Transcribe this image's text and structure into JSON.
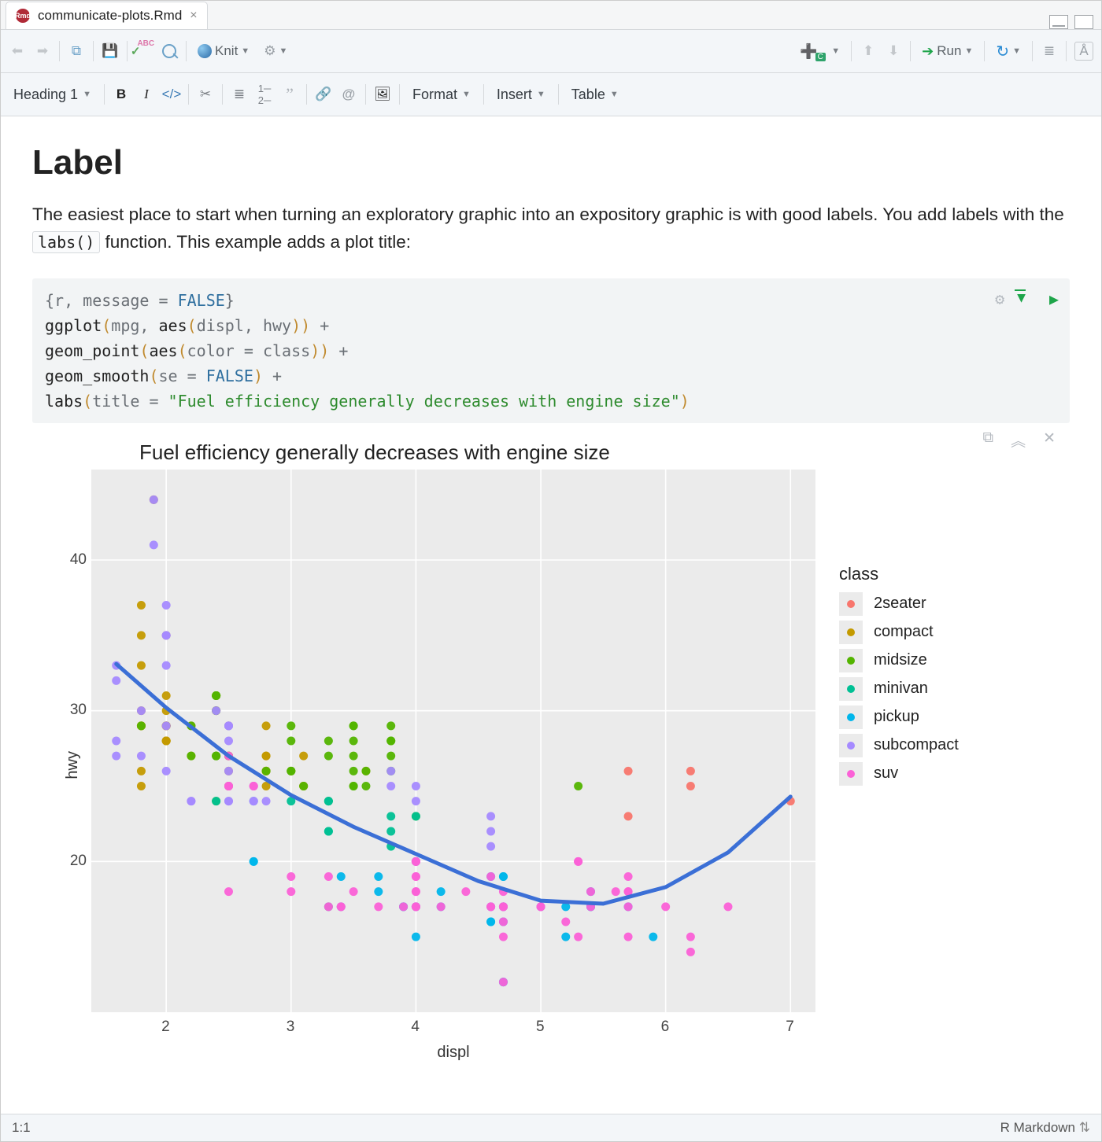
{
  "tab": {
    "filename": "communicate-plots.Rmd"
  },
  "toolbar": {
    "knit": "Knit",
    "run": "Run"
  },
  "toolbar2": {
    "style": "Heading 1",
    "format": "Format",
    "insert": "Insert",
    "table": "Table"
  },
  "document": {
    "heading": "Label",
    "para_pre": "The easiest place to start when turning an exploratory graphic into an expository graphic is with good labels. You add labels with the ",
    "code_inline": "labs()",
    "para_post": " function. This example adds a plot title:"
  },
  "chunk": {
    "header": "{r, message = FALSE}",
    "lines": [
      "ggplot(mpg, aes(displ, hwy)) +",
      "  geom_point(aes(color = class)) +",
      "  geom_smooth(se = FALSE) +",
      "  labs(title = \"Fuel efficiency generally decreases with engine size\")"
    ]
  },
  "chart_data": {
    "type": "scatter",
    "title": "Fuel efficiency generally decreases with engine size",
    "xlabel": "displ",
    "ylabel": "hwy",
    "xlim": [
      1.4,
      7.2
    ],
    "ylim": [
      10,
      46
    ],
    "xticks": [
      2,
      3,
      4,
      5,
      6,
      7
    ],
    "yticks": [
      20,
      30,
      40
    ],
    "legend_title": "class",
    "legend": [
      {
        "name": "2seater",
        "color": "#F8766D"
      },
      {
        "name": "compact",
        "color": "#C49A00"
      },
      {
        "name": "midsize",
        "color": "#53B400"
      },
      {
        "name": "minivan",
        "color": "#00C094"
      },
      {
        "name": "pickup",
        "color": "#00B6EB"
      },
      {
        "name": "subcompact",
        "color": "#A58AFF"
      },
      {
        "name": "suv",
        "color": "#FB61D7"
      }
    ],
    "smooth": [
      {
        "x": 1.6,
        "y": 33.1
      },
      {
        "x": 2.0,
        "y": 30.2
      },
      {
        "x": 2.5,
        "y": 27.0
      },
      {
        "x": 3.0,
        "y": 24.4
      },
      {
        "x": 3.5,
        "y": 22.3
      },
      {
        "x": 4.0,
        "y": 20.5
      },
      {
        "x": 4.5,
        "y": 18.7
      },
      {
        "x": 5.0,
        "y": 17.4
      },
      {
        "x": 5.5,
        "y": 17.2
      },
      {
        "x": 6.0,
        "y": 18.3
      },
      {
        "x": 6.5,
        "y": 20.6
      },
      {
        "x": 7.0,
        "y": 24.3
      }
    ],
    "series": [
      {
        "name": "2seater",
        "points": [
          [
            5.7,
            26
          ],
          [
            5.7,
            23
          ],
          [
            6.2,
            26
          ],
          [
            6.2,
            25
          ],
          [
            7.0,
            24
          ]
        ]
      },
      {
        "name": "compact",
        "points": [
          [
            1.8,
            29
          ],
          [
            1.8,
            29
          ],
          [
            2.0,
            31
          ],
          [
            2.0,
            30
          ],
          [
            2.8,
            26
          ],
          [
            2.8,
            27
          ],
          [
            3.1,
            27
          ],
          [
            1.8,
            26
          ],
          [
            1.8,
            25
          ],
          [
            2.0,
            28
          ],
          [
            2.0,
            29
          ],
          [
            2.8,
            27
          ],
          [
            2.8,
            25
          ],
          [
            3.1,
            25
          ],
          [
            3.1,
            25
          ],
          [
            2.4,
            30
          ],
          [
            2.4,
            30
          ],
          [
            2.5,
            26
          ],
          [
            2.5,
            27
          ],
          [
            2.2,
            27
          ],
          [
            2.2,
            29
          ],
          [
            2.4,
            31
          ],
          [
            2.4,
            31
          ],
          [
            3.0,
            26
          ],
          [
            1.8,
            30
          ],
          [
            1.8,
            33
          ],
          [
            1.8,
            35
          ],
          [
            1.8,
            37
          ],
          [
            2.0,
            35
          ],
          [
            2.0,
            29
          ],
          [
            2.0,
            29
          ],
          [
            2.0,
            28
          ],
          [
            2.0,
            28
          ],
          [
            2.8,
            26
          ],
          [
            1.9,
            44
          ],
          [
            2.0,
            29
          ],
          [
            2.5,
            29
          ],
          [
            1.8,
            29
          ],
          [
            1.8,
            29
          ],
          [
            2.0,
            28
          ],
          [
            2.0,
            29
          ],
          [
            2.8,
            29
          ],
          [
            2.8,
            26
          ],
          [
            3.6,
            26
          ]
        ]
      },
      {
        "name": "midsize",
        "points": [
          [
            2.4,
            27
          ],
          [
            3.1,
            25
          ],
          [
            3.5,
            25
          ],
          [
            3.6,
            25
          ],
          [
            2.4,
            24
          ],
          [
            2.4,
            27
          ],
          [
            3.3,
            24
          ],
          [
            2.5,
            25
          ],
          [
            2.5,
            27
          ],
          [
            3.5,
            29
          ],
          [
            3.5,
            28
          ],
          [
            3.0,
            26
          ],
          [
            3.0,
            29
          ],
          [
            3.5,
            26
          ],
          [
            3.3,
            28
          ],
          [
            3.8,
            26
          ],
          [
            3.8,
            28
          ],
          [
            3.8,
            27
          ],
          [
            5.3,
            25
          ],
          [
            2.2,
            27
          ],
          [
            2.2,
            29
          ],
          [
            2.4,
            27
          ],
          [
            2.4,
            30
          ],
          [
            3.0,
            26
          ],
          [
            3.0,
            28
          ],
          [
            3.3,
            27
          ],
          [
            1.8,
            29
          ],
          [
            2.4,
            31
          ],
          [
            2.4,
            31
          ],
          [
            2.4,
            31
          ],
          [
            3.5,
            27
          ],
          [
            2.8,
            26
          ],
          [
            3.6,
            26
          ],
          [
            3.5,
            25
          ],
          [
            3.5,
            29
          ],
          [
            3.8,
            28
          ],
          [
            3.8,
            29
          ],
          [
            4.0,
            23
          ]
        ]
      },
      {
        "name": "minivan",
        "points": [
          [
            2.4,
            24
          ],
          [
            3.0,
            24
          ],
          [
            3.3,
            22
          ],
          [
            3.3,
            22
          ],
          [
            3.3,
            24
          ],
          [
            3.3,
            24
          ],
          [
            3.3,
            17
          ],
          [
            3.8,
            22
          ],
          [
            3.8,
            21
          ],
          [
            3.8,
            23
          ],
          [
            4.0,
            23
          ]
        ]
      },
      {
        "name": "pickup",
        "points": [
          [
            3.7,
            19
          ],
          [
            3.7,
            18
          ],
          [
            3.9,
            17
          ],
          [
            3.9,
            17
          ],
          [
            4.7,
            19
          ],
          [
            4.7,
            19
          ],
          [
            4.7,
            12
          ],
          [
            5.2,
            17
          ],
          [
            5.2,
            15
          ],
          [
            4.7,
            16
          ],
          [
            4.7,
            12
          ],
          [
            4.7,
            17
          ],
          [
            5.7,
            17
          ],
          [
            5.9,
            15
          ],
          [
            4.2,
            18
          ],
          [
            4.2,
            17
          ],
          [
            4.6,
            16
          ],
          [
            4.6,
            16
          ],
          [
            4.6,
            17
          ],
          [
            5.4,
            17
          ],
          [
            5.4,
            18
          ],
          [
            5.4,
            17
          ],
          [
            4.0,
            17
          ],
          [
            4.0,
            20
          ],
          [
            4.0,
            17
          ],
          [
            4.6,
            19
          ],
          [
            5.0,
            17
          ],
          [
            2.7,
            20
          ],
          [
            2.7,
            24
          ],
          [
            2.7,
            20
          ],
          [
            3.4,
            17
          ],
          [
            3.4,
            19
          ],
          [
            4.0,
            20
          ],
          [
            4.0,
            15
          ],
          [
            4.7,
            17
          ]
        ]
      },
      {
        "name": "subcompact",
        "points": [
          [
            3.8,
            26
          ],
          [
            3.8,
            25
          ],
          [
            4.0,
            25
          ],
          [
            4.0,
            24
          ],
          [
            4.6,
            21
          ],
          [
            4.6,
            22
          ],
          [
            4.6,
            23
          ],
          [
            1.6,
            33
          ],
          [
            1.6,
            32
          ],
          [
            1.6,
            28
          ],
          [
            1.6,
            27
          ],
          [
            2.4,
            30
          ],
          [
            2.5,
            28
          ],
          [
            1.9,
            41
          ],
          [
            1.9,
            44
          ],
          [
            2.0,
            29
          ],
          [
            2.0,
            26
          ],
          [
            2.5,
            29
          ],
          [
            2.5,
            29
          ],
          [
            2.2,
            24
          ],
          [
            2.2,
            24
          ],
          [
            2.5,
            26
          ],
          [
            2.5,
            24
          ],
          [
            2.5,
            24
          ],
          [
            2.5,
            29
          ],
          [
            2.7,
            24
          ],
          [
            2.7,
            24
          ],
          [
            2.8,
            24
          ],
          [
            1.8,
            27
          ],
          [
            1.8,
            30
          ],
          [
            2.0,
            33
          ],
          [
            2.0,
            35
          ],
          [
            2.0,
            37
          ],
          [
            2.0,
            35
          ],
          [
            2.7,
            25
          ]
        ]
      },
      {
        "name": "suv",
        "points": [
          [
            5.3,
            20
          ],
          [
            5.3,
            15
          ],
          [
            5.3,
            20
          ],
          [
            5.7,
            17
          ],
          [
            6.0,
            17
          ],
          [
            5.7,
            19
          ],
          [
            5.7,
            15
          ],
          [
            6.2,
            14
          ],
          [
            6.2,
            15
          ],
          [
            6.5,
            17
          ],
          [
            2.5,
            18
          ],
          [
            4.0,
            17
          ],
          [
            3.9,
            17
          ],
          [
            4.7,
            12
          ],
          [
            4.7,
            17
          ],
          [
            4.7,
            15
          ],
          [
            5.2,
            16
          ],
          [
            5.7,
            18
          ],
          [
            2.7,
            25
          ],
          [
            4.0,
            19
          ],
          [
            4.0,
            20
          ],
          [
            4.6,
            19
          ],
          [
            5.0,
            17
          ],
          [
            3.0,
            19
          ],
          [
            3.0,
            18
          ],
          [
            3.5,
            18
          ],
          [
            3.7,
            17
          ],
          [
            4.0,
            17
          ],
          [
            4.7,
            17
          ],
          [
            4.7,
            17
          ],
          [
            4.7,
            16
          ],
          [
            4.7,
            18
          ],
          [
            4.0,
            20
          ],
          [
            4.2,
            17
          ],
          [
            4.4,
            18
          ],
          [
            4.6,
            17
          ],
          [
            5.4,
            17
          ],
          [
            5.4,
            18
          ],
          [
            4.0,
            17
          ],
          [
            4.0,
            19
          ],
          [
            4.6,
            17
          ],
          [
            5.0,
            17
          ],
          [
            3.3,
            17
          ],
          [
            3.3,
            19
          ],
          [
            4.0,
            18
          ],
          [
            5.6,
            18
          ],
          [
            3.4,
            17
          ],
          [
            3.4,
            17
          ],
          [
            4.0,
            20
          ],
          [
            4.0,
            18
          ],
          [
            4.0,
            20
          ],
          [
            5.7,
            18
          ],
          [
            2.5,
            25
          ],
          [
            2.5,
            27
          ],
          [
            2.5,
            25
          ],
          [
            2.5,
            25
          ],
          [
            2.7,
            25
          ]
        ]
      }
    ]
  },
  "status": {
    "pos": "1:1",
    "lang": "R Markdown"
  }
}
